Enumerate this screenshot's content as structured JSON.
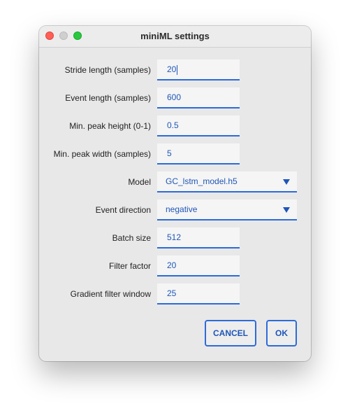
{
  "window": {
    "title": "miniML settings"
  },
  "fields": [
    {
      "label": "Stride length (samples)",
      "value": "20"
    },
    {
      "label": "Event length (samples)",
      "value": "600"
    },
    {
      "label": "Min. peak height (0-1)",
      "value": "0.5"
    },
    {
      "label": "Min. peak width (samples)",
      "value": "5"
    },
    {
      "label": "Model",
      "value": "GC_lstm_model.h5"
    },
    {
      "label": "Event direction",
      "value": "negative"
    },
    {
      "label": "Batch size",
      "value": "512"
    },
    {
      "label": "Filter factor",
      "value": "20"
    },
    {
      "label": "Gradient filter window",
      "value": "25"
    }
  ],
  "buttons": {
    "cancel": "CANCEL",
    "ok": "OK"
  },
  "colors": {
    "accent": "#2d6bd8",
    "value_text": "#1e56b8",
    "window_bg": "#e8e8e8",
    "close": "#fe5f57",
    "minimize": "#cfcfcf",
    "maximize": "#28c840"
  },
  "icons": {
    "close": "close-circle-icon",
    "minimize": "minimize-circle-icon",
    "maximize": "maximize-circle-icon",
    "dropdown": "triangle-down-icon"
  }
}
